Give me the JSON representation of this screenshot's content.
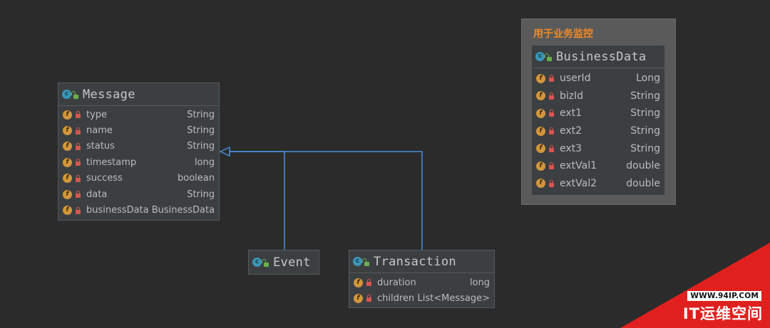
{
  "classes": {
    "message": {
      "name": "Message",
      "fields": [
        {
          "name": "type",
          "type": "String"
        },
        {
          "name": "name",
          "type": "String"
        },
        {
          "name": "status",
          "type": "String"
        },
        {
          "name": "timestamp",
          "type": "long"
        },
        {
          "name": "success",
          "type": "boolean"
        },
        {
          "name": "data",
          "type": "String"
        },
        {
          "name": "businessData",
          "type": "BusinessData"
        }
      ]
    },
    "event": {
      "name": "Event"
    },
    "transaction": {
      "name": "Transaction",
      "fields": [
        {
          "name": "duration",
          "type": "long"
        },
        {
          "name": "children",
          "type": "List<Message>"
        }
      ]
    },
    "business_data": {
      "name": "BusinessData",
      "fields": [
        {
          "name": "userId",
          "type": "Long"
        },
        {
          "name": "bizId",
          "type": "String"
        },
        {
          "name": "ext1",
          "type": "String"
        },
        {
          "name": "ext2",
          "type": "String"
        },
        {
          "name": "ext3",
          "type": "String"
        },
        {
          "name": "extVal1",
          "type": "double"
        },
        {
          "name": "extVal2",
          "type": "double"
        }
      ]
    }
  },
  "group": {
    "title": "用于业务监控"
  },
  "icons": {
    "class": "class-icon",
    "field": "field-icon",
    "visibility_public": "unlocked-icon",
    "visibility_private": "lock-icon"
  },
  "colors": {
    "arrow": "#4a90d9",
    "group_title": "#f08a24",
    "class_icon": "#3a97b8",
    "field_icon": "#d2963c",
    "watermark": "#e0201e"
  },
  "watermark": {
    "url": "WWW.94IP.COM",
    "text": "IT运维空间"
  }
}
